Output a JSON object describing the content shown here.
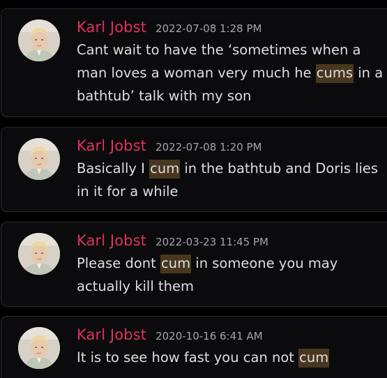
{
  "results": [
    {
      "author": "Karl Jobst",
      "timestamp": "2022-07-08 1:28 PM",
      "segments": [
        {
          "text": "Cant wait to have the ‘sometimes when a man loves a woman very much he ",
          "hl": false
        },
        {
          "text": "cums",
          "hl": true
        },
        {
          "text": " in a bathtub’ talk with my son",
          "hl": false
        }
      ]
    },
    {
      "author": "Karl Jobst",
      "timestamp": "2022-07-08 1:20 PM",
      "segments": [
        {
          "text": "Basically I ",
          "hl": false
        },
        {
          "text": "cum",
          "hl": true
        },
        {
          "text": " in the bathtub and Doris lies in it for a while",
          "hl": false
        }
      ]
    },
    {
      "author": "Karl Jobst",
      "timestamp": "2022-03-23 11:45 PM",
      "segments": [
        {
          "text": "Please dont ",
          "hl": false
        },
        {
          "text": "cum",
          "hl": true
        },
        {
          "text": " in someone you may actually kill them",
          "hl": false
        }
      ]
    },
    {
      "author": "Karl Jobst",
      "timestamp": "2020-10-16 6:41 AM",
      "segments": [
        {
          "text": "It is to see how fast you can not ",
          "hl": false
        },
        {
          "text": "cum",
          "hl": true
        }
      ]
    }
  ],
  "colors": {
    "author": "#e0325e",
    "timestamp": "#a3a5ab",
    "message_text": "#dedfe3",
    "highlight_bg": "#48371e",
    "card_bg": "#0b0b0d",
    "card_border": "#2a2a2f"
  },
  "icons": {
    "avatar": "user-photo-avatar"
  }
}
